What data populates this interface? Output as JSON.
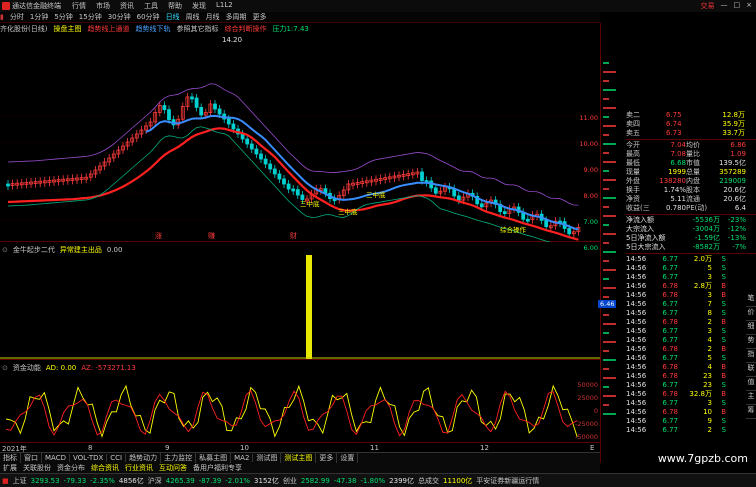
{
  "window": {
    "title": "通达信金融终端",
    "menu": [
      "行情",
      "市场",
      "资讯",
      "工具",
      "帮助",
      "发现",
      "L1L2"
    ],
    "right_items": [
      "交易"
    ]
  },
  "period_tabs": [
    "分时",
    "1分钟",
    "5分钟",
    "15分钟",
    "30分钟",
    "60分钟",
    "日线",
    "周线",
    "月线",
    "多周期",
    "更多"
  ],
  "active_period": "日线",
  "legend": [
    {
      "text": "齐化股份(日线)",
      "color": "#c8c8c8"
    },
    {
      "text": "操盘主图",
      "color": "#ffff00"
    },
    {
      "text": "趋势线上通道",
      "color": "#ff3b3b"
    },
    {
      "text": "趋势线下轨",
      "color": "#4aa3ff"
    },
    {
      "text": "参照其它指标",
      "color": "#c8c8c8"
    },
    {
      "text": "综合判断操作",
      "color": "#ff3b3b"
    },
    {
      "text": "压力1:7.43",
      "color": "#00e070"
    }
  ],
  "price_panel": {
    "axis_labels": [
      "11.00",
      "10.00",
      "9.00",
      "8.00",
      "7.00",
      "6.00"
    ],
    "axis_colors": [
      "#ff3b3b",
      "#ff3b3b",
      "#ff3b3b",
      "#ff3b3b",
      "#00e070",
      "#00e070"
    ],
    "high_mark": "14.20",
    "annotations": [
      {
        "text": "三中底"
      },
      {
        "text": "三中底"
      },
      {
        "text": "三中底"
      },
      {
        "text": "综合操作"
      }
    ],
    "bottom_markers": [
      "涨",
      "赚",
      "财"
    ],
    "current_price_tag": "6.46"
  },
  "sub_panel_1": {
    "title": "金牛起步二代",
    "items": [
      {
        "text": "异常建主出品",
        "color": "#ffff00"
      },
      {
        "text": "0.00",
        "color": "#c8c8c8"
      }
    ]
  },
  "sub_panel_2": {
    "title": "资金动能",
    "items": [
      {
        "text": "AD: 0.00",
        "color": "#ffff00"
      },
      {
        "text": "AZ: -573271.13",
        "color": "#ff3b3b"
      }
    ],
    "axis_labels": [
      "50000",
      "25000",
      "0",
      "-25000",
      "-50000"
    ]
  },
  "date_axis": [
    "2021年",
    "8",
    "9",
    "10",
    "11",
    "12",
    "E"
  ],
  "bottom_tabs": [
    "指标",
    "窗口",
    "MACD",
    "VOL-TDX",
    "CCI",
    "趋势动力",
    "主力监控",
    "私募主图",
    "MA2",
    "测试图",
    "测试主图",
    "更多",
    "设置"
  ],
  "active_bottom_tab": "测试主图",
  "secondary_tabs": [
    "扩展",
    "关联股份",
    "资金分布",
    "综合资讯",
    "行业资讯",
    "互动问答",
    "备用户福利专享"
  ],
  "quote": {
    "asks": [
      {
        "label": "卖二",
        "price": "6.75",
        "vol": "12.8万",
        "price_color": "#ff3b3b"
      },
      {
        "label": "卖四",
        "price": "6.74",
        "vol": "35.9万",
        "price_color": "#ff3b3b"
      },
      {
        "label": "卖五",
        "price": "6.73",
        "vol": "33.7万",
        "price_color": "#ff3b3b"
      }
    ],
    "stats": [
      [
        {
          "k": "今开",
          "v": "7.04",
          "vc": "#ff3b3b"
        },
        {
          "k": "均价",
          "v": "6.86",
          "vc": "#ff3b3b"
        }
      ],
      [
        {
          "k": "最高",
          "v": "7.08",
          "vc": "#ff3b3b"
        },
        {
          "k": "量比",
          "v": "1.09",
          "vc": "#ff3b3b"
        }
      ],
      [
        {
          "k": "最低",
          "v": "6.68",
          "vc": "#00e070"
        },
        {
          "k": "市值",
          "v": "139.5亿",
          "vc": "#e0e0e0"
        }
      ],
      [
        {
          "k": "现量",
          "v": "1999",
          "vc": "#ffff00"
        },
        {
          "k": "总量",
          "v": "357289",
          "vc": "#ffff00"
        }
      ],
      [
        {
          "k": "外盘",
          "v": "138280",
          "vc": "#ff3b3b"
        },
        {
          "k": "内盘",
          "v": "219009",
          "vc": "#00e070"
        }
      ],
      [
        {
          "k": "换手",
          "v": "1.74%",
          "vc": "#e0e0e0"
        },
        {
          "k": "股本",
          "v": "20.6亿",
          "vc": "#e0e0e0"
        }
      ],
      [
        {
          "k": "净资",
          "v": "5.11",
          "vc": "#e0e0e0"
        },
        {
          "k": "流通",
          "v": "20.6亿",
          "vc": "#e0e0e0"
        }
      ],
      [
        {
          "k": "收益(三)",
          "v": "0.780",
          "vc": "#e0e0e0"
        },
        {
          "k": "PE(动)",
          "v": "6.4",
          "vc": "#e0e0e0"
        }
      ]
    ],
    "flows": [
      {
        "label": "净流入额",
        "v1": "-5536万",
        "v2": "-23%"
      },
      {
        "label": "大宗流入",
        "v1": "-3004万",
        "v2": "-12%"
      },
      {
        "label": "5日净流入额",
        "v1": "-1.59亿",
        "v2": "-13%"
      },
      {
        "label": "5日大宗流入",
        "v1": "-8582万",
        "v2": "-7%"
      }
    ],
    "ticks": [
      {
        "time": "14:56",
        "price": "6.77",
        "vol": "2.0万",
        "bs": "S"
      },
      {
        "time": "14:56",
        "price": "6.77",
        "vol": "5",
        "bs": "S"
      },
      {
        "time": "14:56",
        "price": "6.77",
        "vol": "3",
        "bs": "S"
      },
      {
        "time": "14:56",
        "price": "6.78",
        "vol": "2.8万",
        "bs": "B"
      },
      {
        "time": "14:56",
        "price": "6.78",
        "vol": "3",
        "bs": "B"
      },
      {
        "time": "14:56",
        "price": "6.77",
        "vol": "7",
        "bs": "S"
      },
      {
        "time": "14:56",
        "price": "6.77",
        "vol": "8",
        "bs": "S"
      },
      {
        "time": "14:56",
        "price": "6.78",
        "vol": "2",
        "bs": "B"
      },
      {
        "time": "14:56",
        "price": "6.77",
        "vol": "3",
        "bs": "S"
      },
      {
        "time": "14:56",
        "price": "6.77",
        "vol": "4",
        "bs": "S"
      },
      {
        "time": "14:56",
        "price": "6.78",
        "vol": "2",
        "bs": "B"
      },
      {
        "time": "14:56",
        "price": "6.77",
        "vol": "5",
        "bs": "S"
      },
      {
        "time": "14:56",
        "price": "6.78",
        "vol": "4",
        "bs": "B"
      },
      {
        "time": "14:56",
        "price": "6.78",
        "vol": "23",
        "bs": "B"
      },
      {
        "time": "14:56",
        "price": "6.77",
        "vol": "23",
        "bs": "S"
      },
      {
        "time": "14:56",
        "price": "6.78",
        "vol": "32.8万",
        "bs": "B"
      },
      {
        "time": "14:56",
        "price": "6.77",
        "vol": "3",
        "bs": "S"
      },
      {
        "time": "14:56",
        "price": "6.78",
        "vol": "10",
        "bs": "B"
      },
      {
        "time": "14:56",
        "price": "6.77",
        "vol": "9",
        "bs": "S"
      },
      {
        "time": "14:56",
        "price": "6.77",
        "vol": "2",
        "bs": "S"
      }
    ],
    "tabs": [
      "笔",
      "价",
      "细",
      "势",
      "指",
      "联",
      "值",
      "主",
      "筹"
    ]
  },
  "status": {
    "items": [
      {
        "text": "上证",
        "color": "#c8c8c8"
      },
      {
        "text": "3293.53",
        "color": "#00e070"
      },
      {
        "text": "-79.33",
        "color": "#00e070"
      },
      {
        "text": "-2.35%",
        "color": "#00e070"
      },
      {
        "text": "4856亿",
        "color": "#e0e0e0"
      },
      {
        "text": "沪深",
        "color": "#c8c8c8"
      },
      {
        "text": "4265.39",
        "color": "#00e070"
      },
      {
        "text": "-87.39",
        "color": "#00e070"
      },
      {
        "text": "-2.01%",
        "color": "#00e070"
      },
      {
        "text": "3152亿",
        "color": "#e0e0e0"
      },
      {
        "text": "创业",
        "color": "#c8c8c8"
      },
      {
        "text": "2582.99",
        "color": "#00e070"
      },
      {
        "text": "-47.38",
        "color": "#00e070"
      },
      {
        "text": "-1.80%",
        "color": "#00e070"
      },
      {
        "text": "2399亿",
        "color": "#e0e0e0"
      },
      {
        "text": "总成交",
        "color": "#c8c8c8"
      },
      {
        "text": "11100亿",
        "color": "#ffff00"
      },
      {
        "text": "平安证券新疆运行情",
        "color": "#c8c8c8"
      }
    ]
  },
  "watermark": "www.7gpzb.com"
}
